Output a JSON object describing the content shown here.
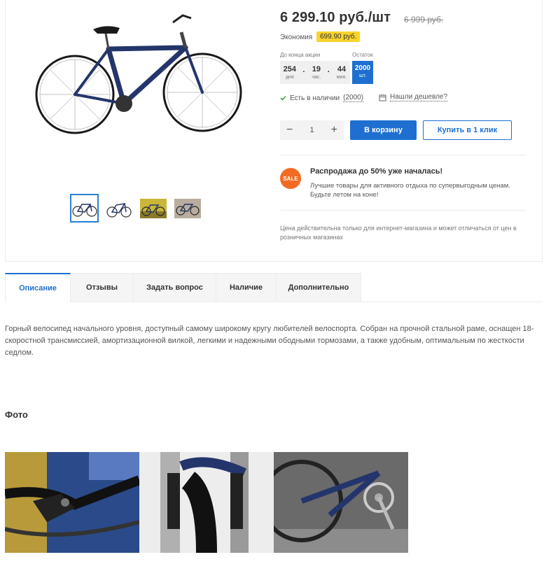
{
  "product": {
    "price": "6 299.10 руб./шт",
    "old_price": "6 999 руб.",
    "economy_label": "Экономия",
    "economy_value": "699.90 руб.",
    "timer_caption": "До конца акции",
    "stock_caption": "Остаток",
    "timer": {
      "days": "254",
      "days_unit": "дня",
      "hours": "19",
      "hours_unit": "час.",
      "minutes": "44",
      "minutes_unit": "мин."
    },
    "stock": {
      "count": "2000",
      "unit": "шт."
    },
    "availability_prefix": "Есть в наличии",
    "availability_count": "(2000)",
    "cheaper_link": "Нашли дешевле?",
    "quantity": "1",
    "qty_minus": "−",
    "qty_plus": "+",
    "cart_button": "В корзину",
    "oneclick_button": "Купить в 1 клик",
    "sale_badge": "SALE",
    "sale_title": "Распродажа до 50% уже началась!",
    "sale_text": "Лучшие товары для активного отдыха по супервыгодным ценам. Будьте летом на коне!",
    "price_note": "Цена действительна только для интернет-магазина и может отличаться от цен в розничных магазинах"
  },
  "tabs": [
    {
      "label": "Описание"
    },
    {
      "label": "Отзывы"
    },
    {
      "label": "Задать вопрос"
    },
    {
      "label": "Наличие"
    },
    {
      "label": "Дополнительно"
    }
  ],
  "description": "Горный велосипед начального уровня, доступный самому широкому кругу любителей велоспорта. Собран на прочной стальной раме, оснащен 18-скоростной трансмиссией, амортизационной вилкой, легкими и надежными ободными тормозами, а также удобным, оптимальным по жесткости седлом.",
  "photo_section_title": "Фото",
  "colors": {
    "accent": "#1e6fd0",
    "economy_bg": "#f8d32c",
    "sale": "#f36b22",
    "available_check": "#3aa33a"
  }
}
